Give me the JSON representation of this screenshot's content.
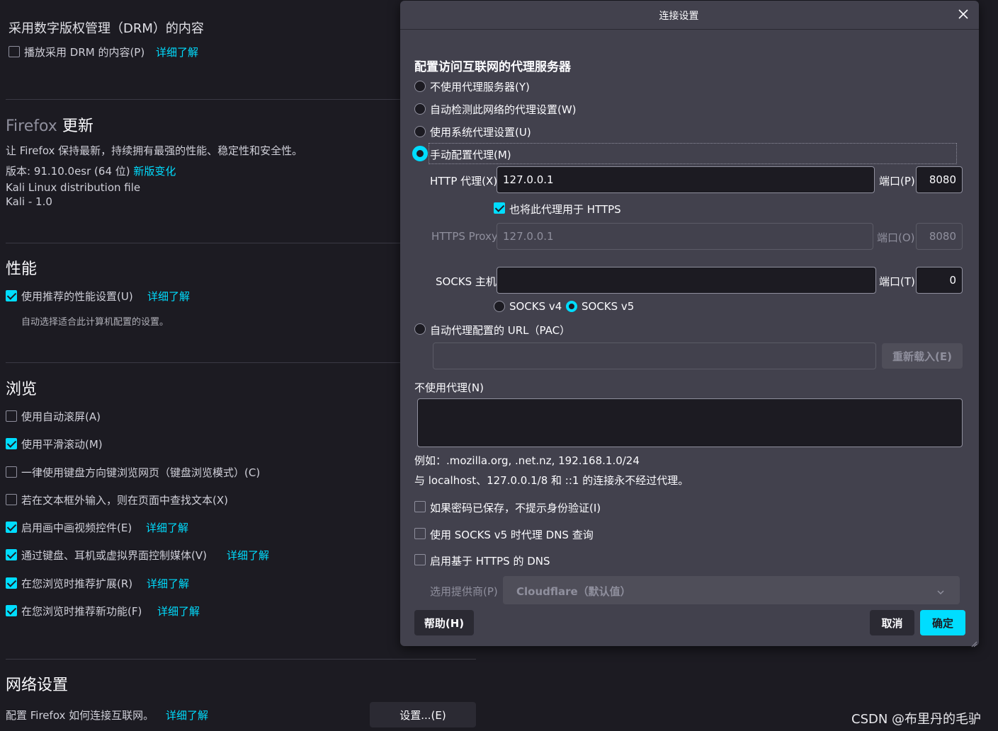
{
  "bg": {
    "drm": {
      "title": "采用数字版权管理（DRM）的内容",
      "checkbox": "播放采用 DRM 的内容(P)",
      "learn_more": "详细了解"
    },
    "update": {
      "title_a": "Firefox",
      "title_b": "更新",
      "desc": "让 Firefox 保持最新，持续拥有最强的性能、稳定性和安全性。",
      "version": "版本: 91.10.0esr (64 位)",
      "whats_new": "新版变化",
      "dist1": "Kali Linux distribution file",
      "dist2": "Kali - 1.0"
    },
    "perf": {
      "title": "性能",
      "checkbox": "使用推荐的性能设置(U)",
      "learn_more": "详细了解",
      "hint": "自动选择适合此计算机配置的设置。"
    },
    "browse": {
      "title": "浏览",
      "items": [
        {
          "label": "使用自动滚屏(A)",
          "checked": false,
          "learn": ""
        },
        {
          "label": "使用平滑滚动(M)",
          "checked": true,
          "learn": ""
        },
        {
          "label": "一律使用键盘方向键浏览网页（键盘浏览模式）(C)",
          "checked": false,
          "learn": ""
        },
        {
          "label": "若在文本框外输入，则在页面中查找文本(X)",
          "checked": false,
          "learn": ""
        },
        {
          "label": "启用画中画视频控件(E)",
          "checked": true,
          "learn": "详细了解"
        },
        {
          "label": "通过键盘、耳机或虚拟界面控制媒体(V)",
          "checked": true,
          "learn": "详细了解"
        },
        {
          "label": "在您浏览时推荐扩展(R)",
          "checked": true,
          "learn": "详细了解"
        },
        {
          "label": "在您浏览时推荐新功能(F)",
          "checked": true,
          "learn": "详细了解"
        }
      ]
    },
    "network": {
      "title": "网络设置",
      "desc": "配置 Firefox 如何连接互联网。",
      "learn_more": "详细了解",
      "button": "设置...(E)"
    },
    "watermark": "CSDN @布里丹的毛驴"
  },
  "dialog": {
    "title": "连接设置",
    "heading": "配置访问互联网的代理服务器",
    "options": [
      "不使用代理服务器(Y)",
      "自动检测此网络的代理设置(W)",
      "使用系统代理设置(U)",
      "手动配置代理(M)"
    ],
    "http_label": "HTTP 代理(X)",
    "http_value": "127.0.0.1",
    "port_p": "端口(P)",
    "http_port": "8080",
    "also_https": "也将此代理用于 HTTPS",
    "https_label": "HTTPS Proxy",
    "https_value": "127.0.0.1",
    "port_o": "端口(O)",
    "https_port": "8080",
    "socks_label": "SOCKS 主机",
    "socks_value": "",
    "port_t": "端口(T)",
    "socks_port": "0",
    "socks_v4": "SOCKS v4",
    "socks_v5": "SOCKS v5",
    "pac_label": "自动代理配置的 URL（PAC）",
    "pac_value": "",
    "reload": "重新载入(E)",
    "no_proxy_label": "不使用代理(N)",
    "no_proxy_value": "",
    "example": "例如：.mozilla.org, .net.nz, 192.168.1.0/24",
    "localhost_note": "与 localhost、127.0.0.1/8 和 ::1 的连接永不经过代理。",
    "check_auth": "如果密码已保存，不提示身份验证(I)",
    "check_dns": "使用 SOCKS v5 时代理 DNS 查询",
    "check_doh": "启用基于 HTTPS 的 DNS",
    "provider_label": "选用提供商(P)",
    "provider_value": "Cloudflare（默认值）",
    "help": "帮助(H)",
    "cancel": "取消",
    "ok": "确定",
    "accent": "#00ddff"
  }
}
